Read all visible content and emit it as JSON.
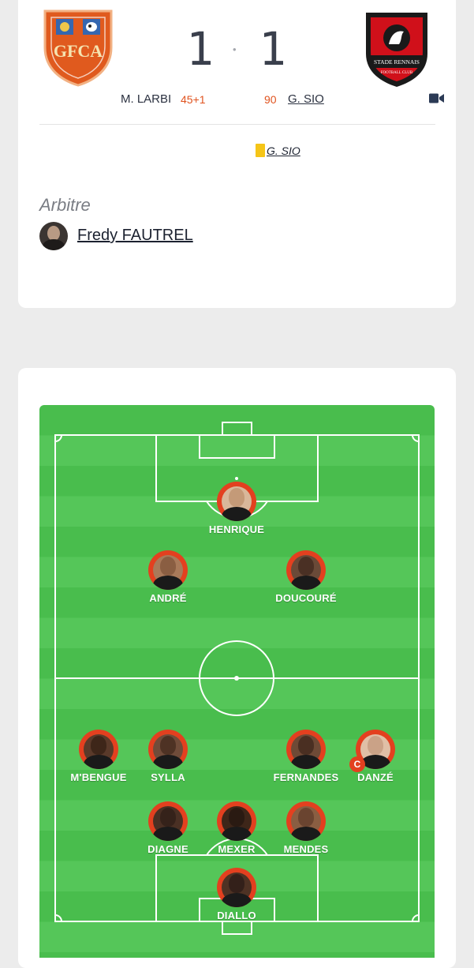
{
  "match": {
    "home": {
      "crest_text": "GFCA",
      "crest_color": "#e05a1e"
    },
    "away": {
      "crest_text": "STADE RENNAIS",
      "crest_sub": "FOOTBALL CLUB",
      "crest_color": "#d0101a"
    },
    "score_home": "1",
    "score_sep": "•",
    "score_away": "1",
    "home_scorer": {
      "name": "M. LARBI",
      "minute": "45+1"
    },
    "away_scorer": {
      "name": "G. SIO",
      "minute": "90"
    },
    "video_icon": "video-camera-icon",
    "card_event": {
      "player": "G. SIO",
      "card": "yellow",
      "color": "#f5c518"
    }
  },
  "referee": {
    "heading": "Arbitre",
    "name": "Fredy FAUTREL"
  },
  "lineup": {
    "pitch_colors": [
      "#49bd4d",
      "#55c659"
    ],
    "players": [
      {
        "name": "HENRIQUE"
      },
      {
        "name": "ANDRÉ"
      },
      {
        "name": "DOUCOURÉ"
      },
      {
        "name": "M'BENGUE"
      },
      {
        "name": "SYLLA"
      },
      {
        "name": "FERNANDES"
      },
      {
        "name": "DANZÉ",
        "captain": "C"
      },
      {
        "name": "DIAGNE"
      },
      {
        "name": "MEXER"
      },
      {
        "name": "MENDES"
      },
      {
        "name": "DIALLO"
      }
    ]
  }
}
